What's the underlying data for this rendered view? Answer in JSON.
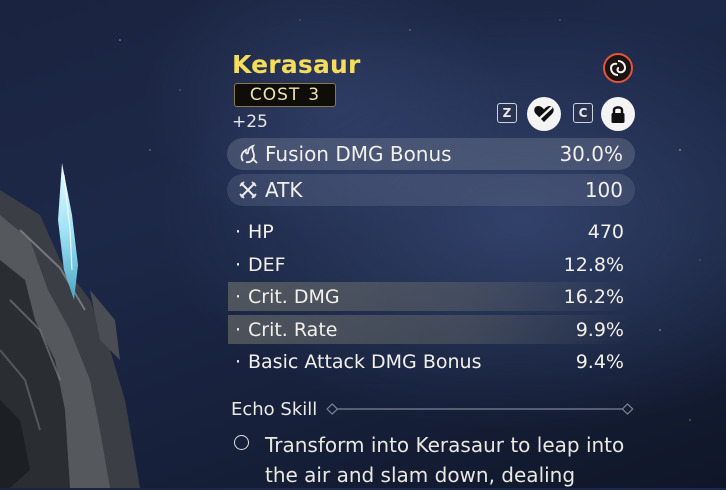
{
  "echo": {
    "name": "Kerasaur",
    "cost_label": "COST",
    "cost_value": "3",
    "level": "+25"
  },
  "controls": {
    "key_z": "Z",
    "key_c": "C",
    "element_icon": "fusion-element-icon",
    "discard_icon": "heart-discard-icon",
    "lock_icon": "lock-icon"
  },
  "main_stats": [
    {
      "icon": "fusion-icon",
      "label": "Fusion DMG Bonus",
      "value": "30.0%"
    },
    {
      "icon": "atk-swords-icon",
      "label": "ATK",
      "value": "100"
    }
  ],
  "sub_stats": [
    {
      "bullet": "·",
      "label": "HP",
      "value": "470",
      "highlighted": false
    },
    {
      "bullet": "·",
      "label": "DEF",
      "value": "12.8%",
      "highlighted": false
    },
    {
      "bullet": "·",
      "label": "Crit. DMG",
      "value": "16.2%",
      "highlighted": true
    },
    {
      "bullet": "·",
      "label": "Crit. Rate",
      "value": "9.9%",
      "highlighted": true
    },
    {
      "bullet": "·",
      "label": "Basic Attack DMG Bonus",
      "value": "9.4%",
      "highlighted": false
    }
  ],
  "echo_skill": {
    "title": "Echo Skill",
    "description": "Transform into Kerasaur to leap into the air and slam down, dealing"
  },
  "colors": {
    "title": "#f5dc5a",
    "fusion": "#e4553a"
  }
}
